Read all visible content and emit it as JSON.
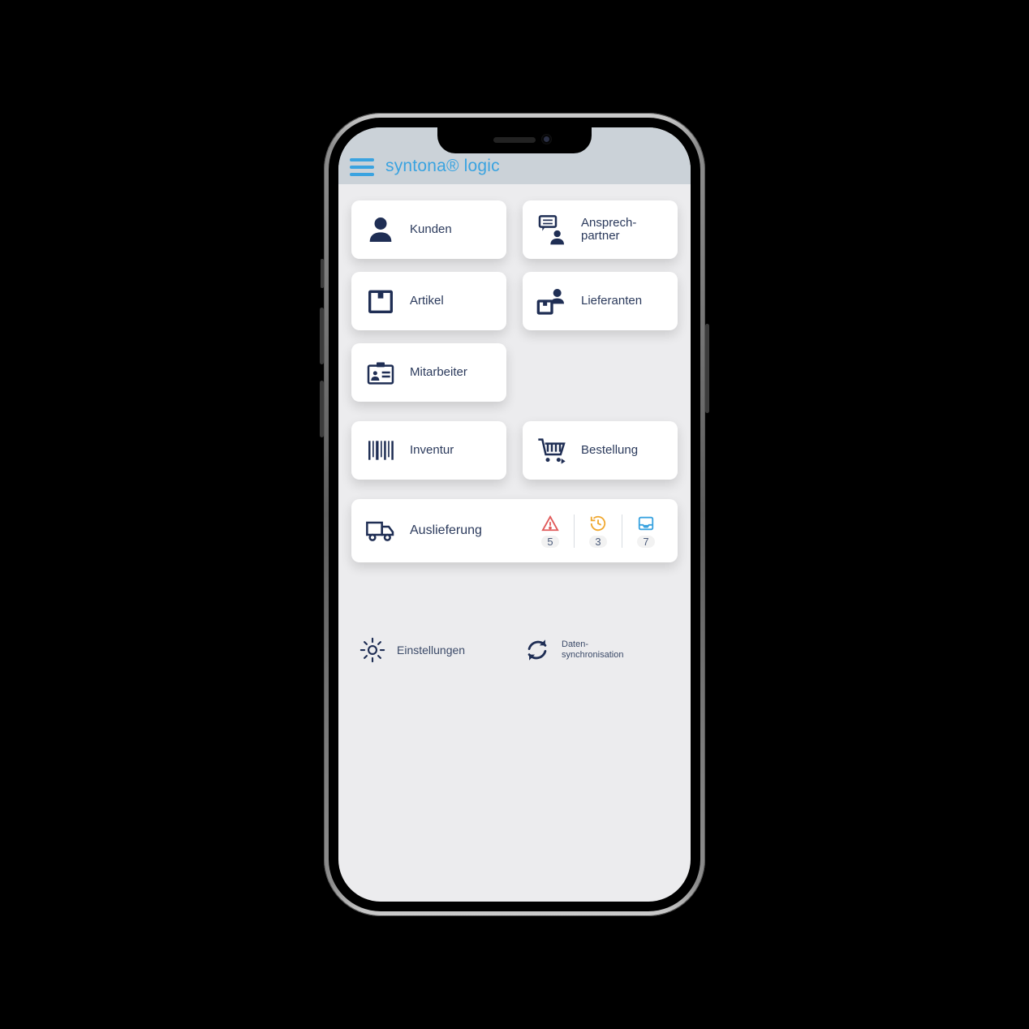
{
  "header": {
    "title": "syntona® logic"
  },
  "tiles": {
    "group1": [
      {
        "label": "Kunden"
      },
      {
        "label": "Ansprech-\npartner"
      },
      {
        "label": "Artikel"
      },
      {
        "label": "Lieferanten"
      },
      {
        "label": "Mitarbeiter"
      }
    ],
    "group2": [
      {
        "label": "Inventur"
      },
      {
        "label": "Bestellung"
      }
    ]
  },
  "delivery": {
    "label": "Auslieferung",
    "stats": {
      "warning": "5",
      "pending": "3",
      "inbox": "7"
    }
  },
  "footer": {
    "settings": "Einstellungen",
    "sync_line1": "Daten-",
    "sync_line2": "synchronisation"
  }
}
